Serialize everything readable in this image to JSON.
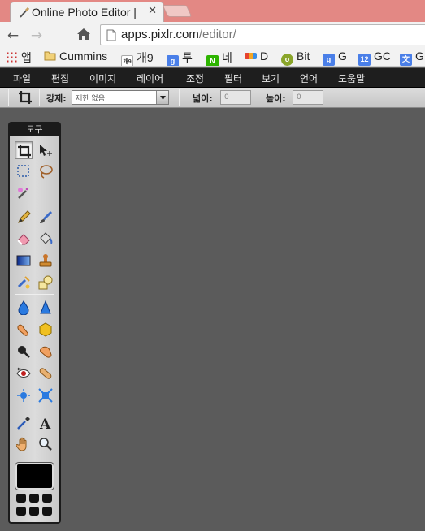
{
  "browser": {
    "tab": {
      "title": "Online Photo Editor |"
    },
    "omnibox": {
      "host": "apps.pixlr.com",
      "path": "/editor/"
    },
    "bookmarks": [
      {
        "label": "앱",
        "icon": "apps-grid-icon",
        "color": "#c33"
      },
      {
        "label": "Cummins",
        "icon": "folder-icon",
        "color": "#e0b040"
      },
      {
        "label": "개9",
        "icon": "gae9-icon",
        "color": "#333"
      },
      {
        "label": "투",
        "icon": "google-g-icon",
        "color": "#4a7fe8"
      },
      {
        "label": "네",
        "icon": "naver-icon",
        "color": "#2db400"
      },
      {
        "label": "D",
        "icon": "daum-icon",
        "color": "#e6432e"
      },
      {
        "label": "Bit",
        "icon": "bit-icon",
        "color": "#7a9a2a"
      },
      {
        "label": "G",
        "icon": "google-g-icon",
        "color": "#4a7fe8"
      },
      {
        "label": "GC",
        "icon": "calendar-12-icon",
        "color": "#4a7fe8"
      },
      {
        "label": "G",
        "icon": "translate-icon",
        "color": "#4a7fe8"
      }
    ],
    "calendar_day": "12"
  },
  "menubar": [
    "파일",
    "편집",
    "이미지",
    "레이어",
    "조정",
    "필터",
    "보기",
    "언어",
    "도움말"
  ],
  "options": {
    "constraint_label": "강제:",
    "constraint_value": "제한 없음",
    "width_label": "넓이:",
    "width_value": "0",
    "height_label": "높이:",
    "height_value": "0"
  },
  "tools": {
    "title": "도구",
    "items": [
      "crop-tool",
      "move-tool",
      "marquee-tool",
      "lasso-tool",
      "wand-tool",
      "pencil-tool",
      "brush-tool",
      "eraser-tool",
      "bucket-tool",
      "gradient-tool",
      "clone-stamp-tool",
      "color-replace-tool",
      "drawing-tool",
      "blur-tool",
      "sharpen-tool",
      "smudge-tool",
      "sponge-tool",
      "dodge-tool",
      "burn-tool",
      "red-eye-tool",
      "spot-heal-tool",
      "bloat-tool",
      "pinch-tool",
      "color-picker-tool",
      "type-tool",
      "hand-tool",
      "zoom-tool"
    ]
  },
  "colors": {
    "canvas_bg": "#5b5b5b",
    "tabstrip": "#e38884",
    "menubar": "#1e1e1e",
    "foreground_swatch": "#000000"
  }
}
